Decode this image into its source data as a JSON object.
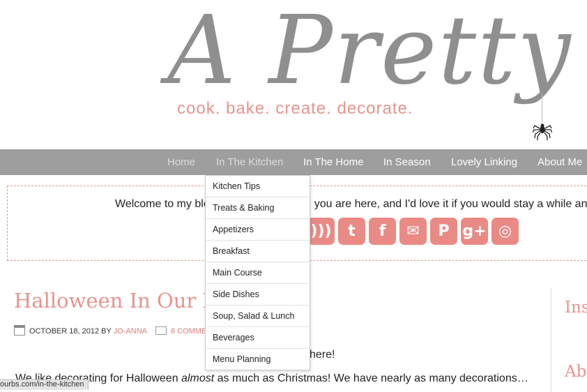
{
  "site": {
    "logo_text": "A Pretty Life",
    "tagline": "cook.  bake.  create.  decorate."
  },
  "nav": {
    "items": [
      {
        "label": "Home"
      },
      {
        "label": "In The Kitchen"
      },
      {
        "label": "In The Home"
      },
      {
        "label": "In Season"
      },
      {
        "label": "Lovely Linking"
      },
      {
        "label": "About Me"
      }
    ]
  },
  "dropdown": {
    "items": [
      {
        "label": "Kitchen Tips"
      },
      {
        "label": "Treats & Baking"
      },
      {
        "label": "Appetizers"
      },
      {
        "label": "Breakfast"
      },
      {
        "label": "Main Course"
      },
      {
        "label": "Side Dishes"
      },
      {
        "label": "Soup, Salad & Lunch"
      },
      {
        "label": "Beverages"
      },
      {
        "label": "Menu Planning"
      }
    ]
  },
  "welcome": {
    "text_left": "Welcome to my blo",
    "text_right": "you are here, and I'd love it if you would stay a while and v"
  },
  "social": {
    "buttons": [
      {
        "icon": "rss-icon",
        "glyph": ")))"
      },
      {
        "icon": "twitter-icon",
        "glyph": "t"
      },
      {
        "icon": "facebook-icon",
        "glyph": "f"
      },
      {
        "icon": "email-icon",
        "glyph": "✉"
      },
      {
        "icon": "pinterest-icon",
        "glyph": "P"
      },
      {
        "icon": "googleplus-icon",
        "glyph": "g+"
      },
      {
        "icon": "instagram-icon",
        "glyph": "◎"
      }
    ],
    "color": "#ea8a85"
  },
  "post": {
    "title": "Halloween In Our H",
    "date": "OCTOBER 18, 2012",
    "by": "BY",
    "author": "JO-ANNA",
    "comments": "6 COMME",
    "body_fragment": "here!",
    "body_before_em": "We like decorating for Halloween ",
    "body_em": "almost",
    "body_after_em": " as much as Christmas!  We have nearly as many decorations…"
  },
  "sidebar": {
    "headings": [
      "Insp",
      "Ab"
    ]
  },
  "status_bar": {
    "url": "ourbs.com/in-the-kitchen"
  },
  "colors": {
    "accent": "#e8938d",
    "nav_bg": "#9e9e9e",
    "logo_gray": "#8f8f8f"
  }
}
